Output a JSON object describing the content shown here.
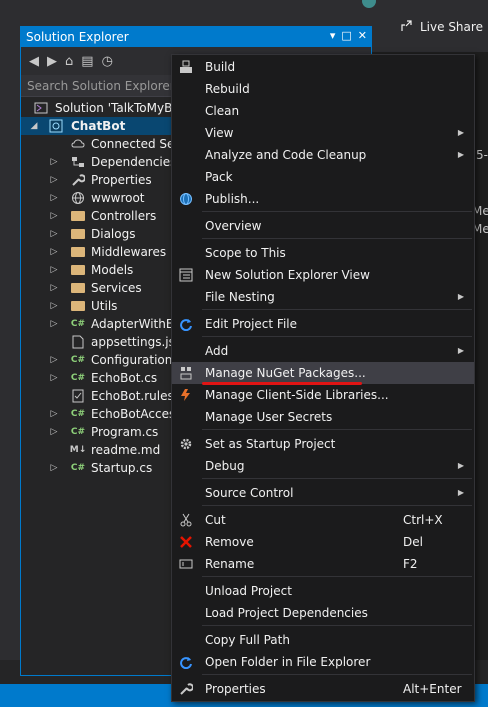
{
  "topbar": {
    "live_share": "Live Share"
  },
  "solution_explorer": {
    "title": "Solution Explorer",
    "search_placeholder": "Search Solution Explorer (C",
    "tree": [
      {
        "label": "Solution 'TalkToMyBot",
        "type": "solution"
      },
      {
        "label": "ChatBot",
        "type": "project"
      },
      {
        "label": "Connected Ser",
        "type": "connected"
      },
      {
        "label": "Dependencies",
        "type": "deps"
      },
      {
        "label": "Properties",
        "type": "props"
      },
      {
        "label": "wwwroot",
        "type": "globe"
      },
      {
        "label": "Controllers",
        "type": "folder"
      },
      {
        "label": "Dialogs",
        "type": "folder"
      },
      {
        "label": "Middlewares",
        "type": "folder"
      },
      {
        "label": "Models",
        "type": "folder"
      },
      {
        "label": "Services",
        "type": "folder"
      },
      {
        "label": "Utils",
        "type": "folder"
      },
      {
        "label": "AdapterWithEr",
        "type": "cs"
      },
      {
        "label": "appsettings.jso",
        "type": "json"
      },
      {
        "label": "ConfigurationC",
        "type": "cs"
      },
      {
        "label": "EchoBot.cs",
        "type": "cs"
      },
      {
        "label": "EchoBot.rulese",
        "type": "ruleset"
      },
      {
        "label": "EchoBotAccess",
        "type": "cs"
      },
      {
        "label": "Program.cs",
        "type": "cs"
      },
      {
        "label": "readme.md",
        "type": "md"
      },
      {
        "label": "Startup.cs",
        "type": "cs"
      }
    ]
  },
  "right_pane": {
    "line1": "5-",
    "line2": "Me",
    "line3": "Me"
  },
  "context_menu": {
    "items": [
      {
        "label": "Build",
        "icon": "build-icon",
        "shortcut": "",
        "submenu": false
      },
      {
        "label": "Rebuild",
        "icon": "",
        "shortcut": "",
        "submenu": false
      },
      {
        "label": "Clean",
        "icon": "",
        "shortcut": "",
        "submenu": false
      },
      {
        "label": "View",
        "icon": "",
        "shortcut": "",
        "submenu": true
      },
      {
        "label": "Analyze and Code Cleanup",
        "icon": "",
        "shortcut": "",
        "submenu": true
      },
      {
        "label": "Pack",
        "icon": "",
        "shortcut": "",
        "submenu": false
      },
      {
        "label": "Publish...",
        "icon": "globe-icon",
        "shortcut": "",
        "submenu": false
      },
      {
        "label": "Overview",
        "icon": "",
        "shortcut": "",
        "submenu": false
      },
      {
        "label": "Scope to This",
        "icon": "",
        "shortcut": "",
        "submenu": false
      },
      {
        "label": "New Solution Explorer View",
        "icon": "new-view-icon",
        "shortcut": "",
        "submenu": false
      },
      {
        "label": "File Nesting",
        "icon": "",
        "shortcut": "",
        "submenu": true
      },
      {
        "label": "Edit Project File",
        "icon": "refresh-icon",
        "shortcut": "",
        "submenu": false
      },
      {
        "label": "Add",
        "icon": "",
        "shortcut": "",
        "submenu": true
      },
      {
        "label": "Manage NuGet Packages...",
        "icon": "nuget-icon",
        "shortcut": "",
        "submenu": false
      },
      {
        "label": "Manage Client-Side Libraries...",
        "icon": "library-icon",
        "shortcut": "",
        "submenu": false
      },
      {
        "label": "Manage User Secrets",
        "icon": "",
        "shortcut": "",
        "submenu": false
      },
      {
        "label": "Set as Startup Project",
        "icon": "gear-icon",
        "shortcut": "",
        "submenu": false
      },
      {
        "label": "Debug",
        "icon": "",
        "shortcut": "",
        "submenu": true
      },
      {
        "label": "Source Control",
        "icon": "",
        "shortcut": "",
        "submenu": true
      },
      {
        "label": "Cut",
        "icon": "scissors-icon",
        "shortcut": "Ctrl+X",
        "submenu": false
      },
      {
        "label": "Remove",
        "icon": "remove-icon",
        "shortcut": "Del",
        "submenu": false
      },
      {
        "label": "Rename",
        "icon": "rename-icon",
        "shortcut": "F2",
        "submenu": false
      },
      {
        "label": "Unload Project",
        "icon": "",
        "shortcut": "",
        "submenu": false
      },
      {
        "label": "Load Project Dependencies",
        "icon": "",
        "shortcut": "",
        "submenu": false
      },
      {
        "label": "Copy Full Path",
        "icon": "",
        "shortcut": "",
        "submenu": false
      },
      {
        "label": "Open Folder in File Explorer",
        "icon": "refresh-icon",
        "shortcut": "",
        "submenu": false
      },
      {
        "label": "Properties",
        "icon": "wrench-icon",
        "shortcut": "Alt+Enter",
        "submenu": false
      }
    ],
    "highlighted": "Manage NuGet Packages..."
  },
  "colors": {
    "accent": "#007acc",
    "selection": "#094771",
    "underline": "#e01414"
  }
}
